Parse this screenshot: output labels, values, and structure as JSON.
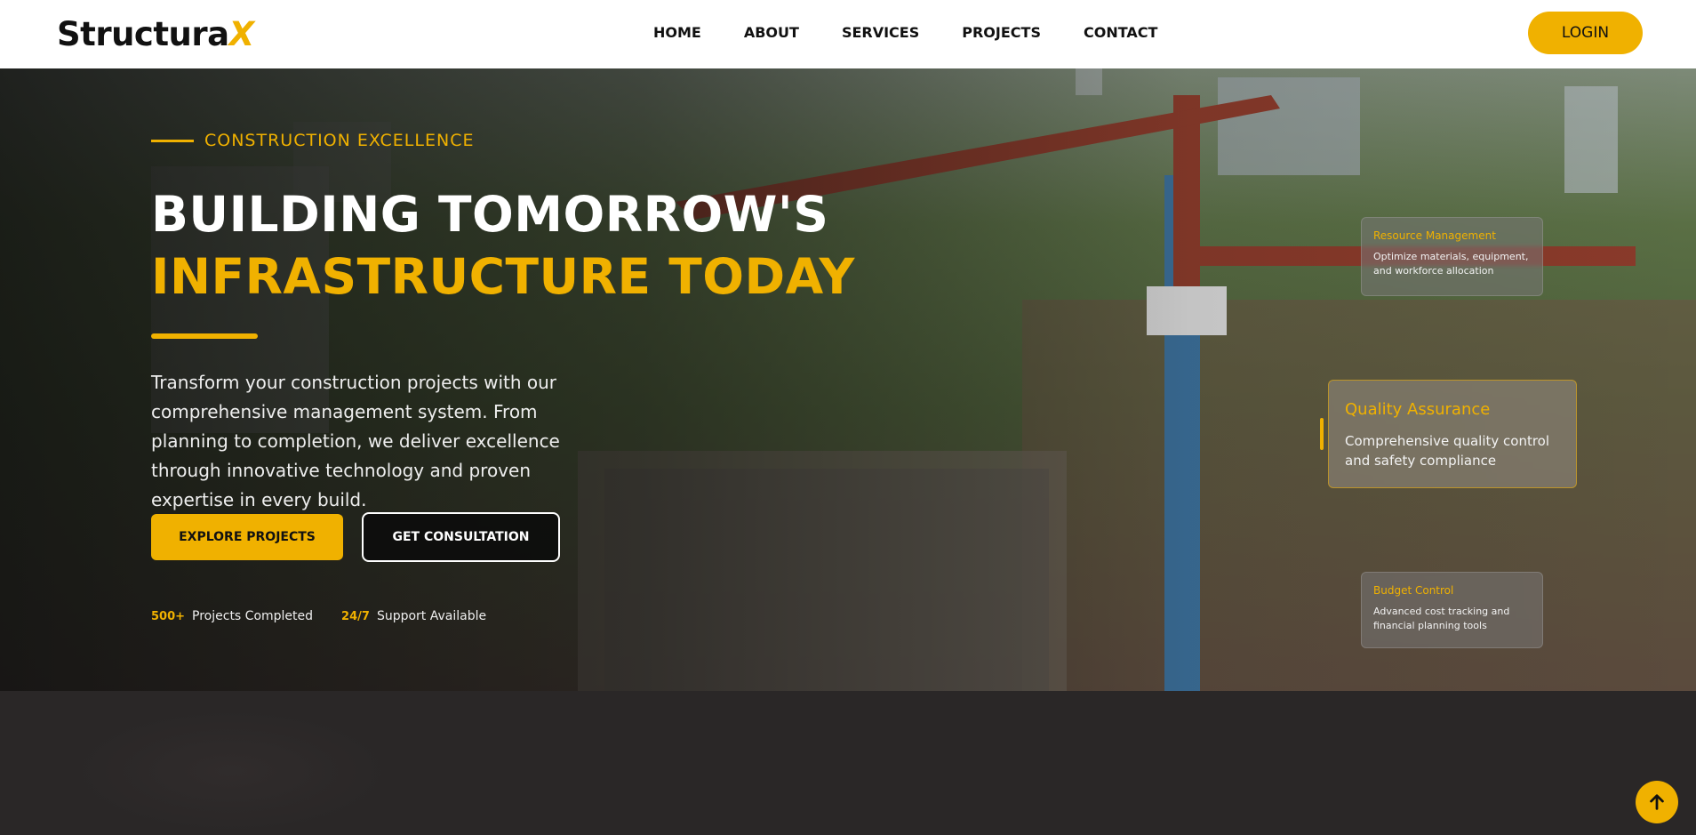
{
  "header": {
    "logo_main": "Structura",
    "logo_accent": "X",
    "nav": [
      "HOME",
      "ABOUT",
      "SERVICES",
      "PROJECTS",
      "CONTACT"
    ],
    "login_label": "LOGIN"
  },
  "hero": {
    "eyebrow": "CONSTRUCTION EXCELLENCE",
    "title_line1": "BUILDING TOMORROW'S",
    "title_line2": "INFRASTRUCTURE TODAY",
    "description": "Transform your construction projects with our comprehensive management system. From planning to completion, we deliver excellence through innovative technology and proven expertise in every build.",
    "primary_button": "EXPLORE PROJECTS",
    "secondary_button": "GET CONSULTATION",
    "stats": [
      {
        "value": "500+",
        "label": "Projects Completed"
      },
      {
        "value": "24/7",
        "label": "Support Available"
      }
    ]
  },
  "cards": {
    "resource": {
      "title": "Resource Management",
      "text": "Optimize materials, equipment, and workforce allocation"
    },
    "quality": {
      "title": "Quality Assurance",
      "text": "Comprehensive quality control and safety compliance"
    },
    "budget": {
      "title": "Budget Control",
      "text": "Advanced cost tracking and financial planning tools"
    }
  },
  "colors": {
    "accent": "#f0b100",
    "dark": "#2a2727",
    "header_bg": "#ffffff"
  },
  "icons": {
    "scroll_top": "arrow-up-icon"
  }
}
